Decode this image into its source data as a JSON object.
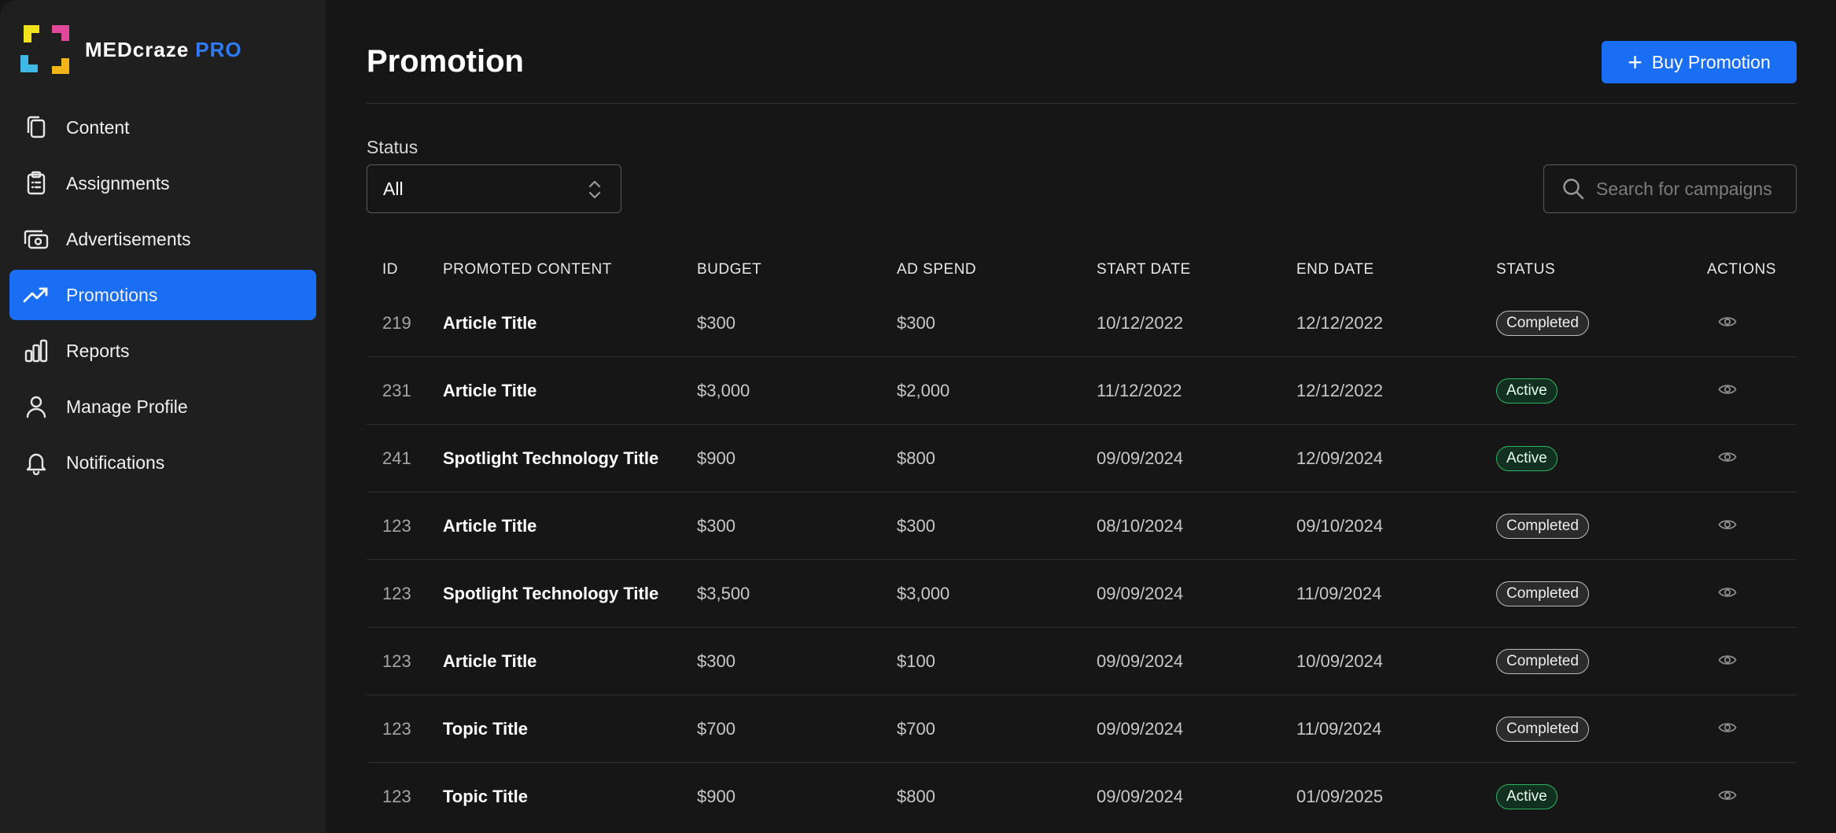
{
  "brand": {
    "name": "MEDcraze",
    "suffix": "PRO"
  },
  "sidebar": {
    "items": [
      {
        "label": "Content",
        "icon": "copy-icon",
        "active": false
      },
      {
        "label": "Assignments",
        "icon": "clipboard-icon",
        "active": false
      },
      {
        "label": "Advertisements",
        "icon": "advertisement-icon",
        "active": false
      },
      {
        "label": "Promotions",
        "icon": "trending-up-icon",
        "active": true
      },
      {
        "label": "Reports",
        "icon": "bar-chart-icon",
        "active": false
      },
      {
        "label": "Manage Profile",
        "icon": "user-icon",
        "active": false
      },
      {
        "label": "Notifications",
        "icon": "bell-icon",
        "active": false
      }
    ]
  },
  "header": {
    "title": "Promotion",
    "buy_button": "Buy Promotion"
  },
  "filters": {
    "status_label": "Status",
    "status_value": "All",
    "search_placeholder": "Search for campaigns"
  },
  "table": {
    "headers": [
      "ID",
      "PROMOTED CONTENT",
      "BUDGET",
      "AD SPEND",
      "START DATE",
      "END DATE",
      "STATUS",
      "ACTIONS"
    ],
    "rows": [
      {
        "id": "219",
        "content": "Article Title",
        "budget": " $300",
        "spend": " $300",
        "start": "10/12/2022",
        "end": "12/12/2022",
        "status": "Completed"
      },
      {
        "id": "231",
        "content": "Article Title",
        "budget": "$3,000",
        "spend": "$2,000",
        "start": "11/12/2022",
        "end": "12/12/2022",
        "status": "Active"
      },
      {
        "id": "241",
        "content": "Spotlight Technology Title",
        "budget": "$900",
        "spend": "$800",
        "start": "09/09/2024",
        "end": "12/09/2024",
        "status": "Active"
      },
      {
        "id": "123",
        "content": "Article Title",
        "budget": "$300",
        "spend": "$300",
        "start": "08/10/2024",
        "end": "09/10/2024",
        "status": "Completed"
      },
      {
        "id": "123",
        "content": "Spotlight Technology Title",
        "budget": "$3,500",
        "spend": "$3,000",
        "start": "09/09/2024",
        "end": "11/09/2024",
        "status": "Completed"
      },
      {
        "id": "123",
        "content": "Article Title",
        "budget": "$300",
        "spend": "$100",
        "start": "09/09/2024",
        "end": "10/09/2024",
        "status": "Completed"
      },
      {
        "id": "123",
        "content": "Topic Title",
        "budget": "$700",
        "spend": "$700",
        "start": "09/09/2024",
        "end": "11/09/2024",
        "status": "Completed"
      },
      {
        "id": "123",
        "content": "Topic Title",
        "budget": "$900",
        "spend": "$800",
        "start": "09/09/2024",
        "end": "01/09/2025",
        "status": "Active"
      }
    ]
  },
  "colors": {
    "accent": "#1a6ef3",
    "active_badge": "#2fb560",
    "completed_badge": "#bdbdbd"
  }
}
